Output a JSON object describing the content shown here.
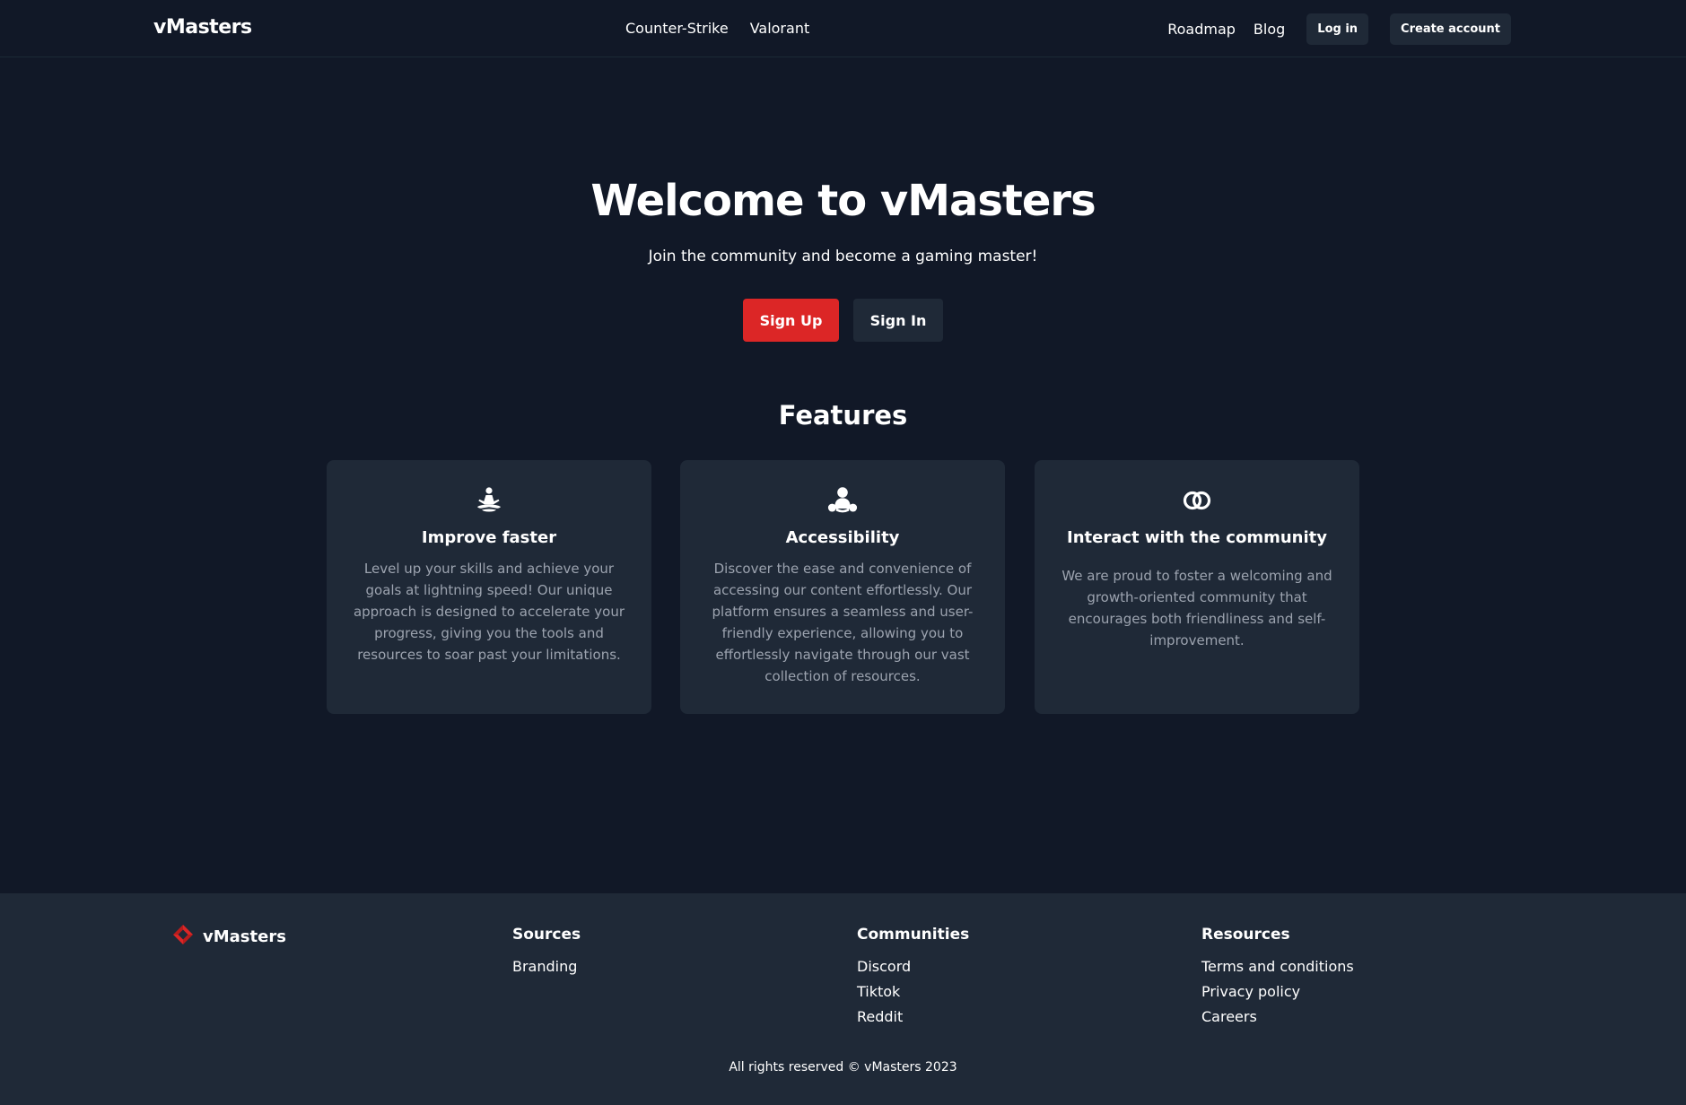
{
  "header": {
    "brand": "vMasters",
    "nav_center": [
      "Counter-Strike",
      "Valorant"
    ],
    "nav_right": [
      "Roadmap",
      "Blog"
    ],
    "login_label": "Log in",
    "create_account_label": "Create account"
  },
  "hero": {
    "title": "Welcome to vMasters",
    "subtitle": "Join the community and become a gaming master!",
    "signup_label": "Sign Up",
    "signin_label": "Sign In"
  },
  "features": {
    "title": "Features",
    "cards": [
      {
        "icon": "meditation-icon",
        "title": "Improve faster",
        "text": "Level up your skills and achieve your goals at lightning speed! Our unique approach is designed to accelerate your progress, giving you the tools and resources to soar past your limitations."
      },
      {
        "icon": "people-group-icon",
        "title": "Accessibility",
        "text": "Discover the ease and convenience of accessing our content effortlessly. Our platform ensures a seamless and user-friendly experience, allowing you to effortlessly navigate through our vast collection of resources."
      },
      {
        "icon": "interlocked-rings-icon",
        "title": "Interact with the community",
        "text": "We are proud to foster a welcoming and growth-oriented community that encourages both friendliness and self-improvement."
      }
    ]
  },
  "footer": {
    "brand": "vMasters",
    "columns": [
      {
        "heading": "Sources",
        "links": [
          "Branding"
        ]
      },
      {
        "heading": "Communities",
        "links": [
          "Discord",
          "Tiktok",
          "Reddit"
        ]
      },
      {
        "heading": "Resources",
        "links": [
          "Terms and conditions",
          "Privacy policy",
          "Careers"
        ]
      }
    ],
    "copyright": "All rights reserved © vMasters 2023"
  },
  "colors": {
    "background": "#111827",
    "surface": "#1f2937",
    "accent": "#dc2626",
    "muted_text": "#9ca3af"
  }
}
